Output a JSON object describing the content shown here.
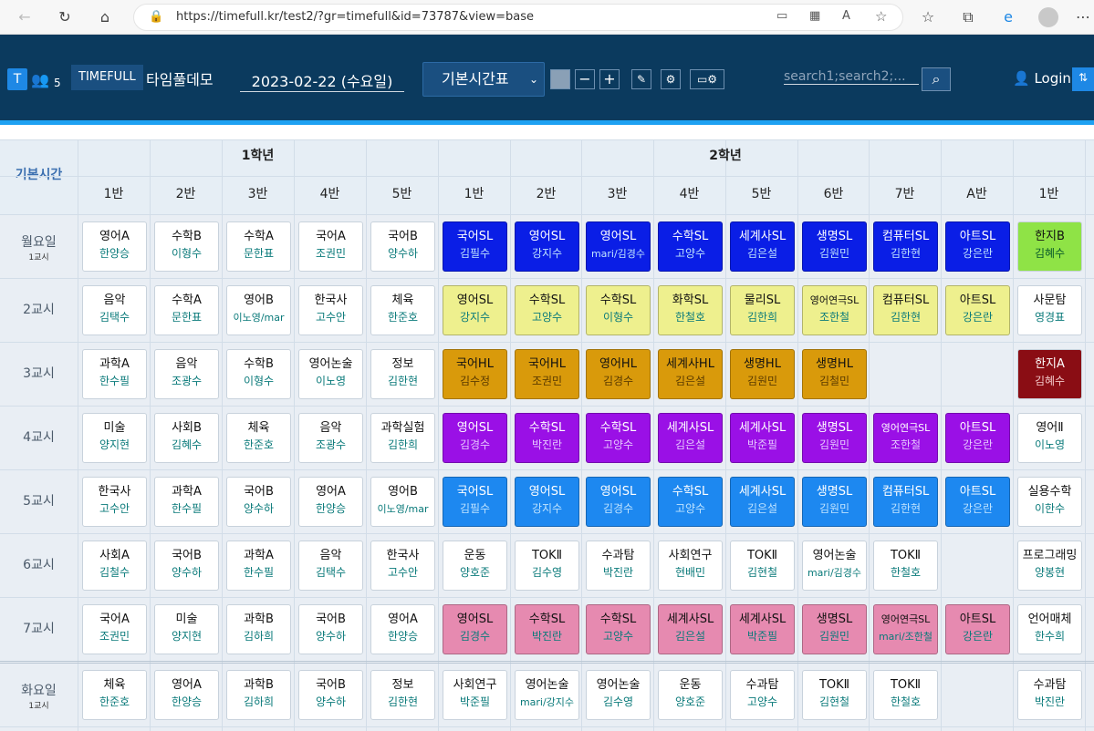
{
  "browser": {
    "url": "https://timefull.kr/test2/?gr=timefull&id=73787&view=base"
  },
  "app": {
    "user_count": "5",
    "brand": "TIMEFULL",
    "name": "타임풀데모",
    "date": "2023-02-22 (수요일)",
    "view_select": "기본시간표",
    "search_placeholder": "search1;search2;...",
    "login": "Login"
  },
  "table": {
    "corner": "기본시간",
    "grades": [
      {
        "label": "1학년"
      },
      {
        "label": "2학년"
      }
    ],
    "columns": [
      "1반",
      "2반",
      "3반",
      "4반",
      "5반",
      "1반",
      "2반",
      "3반",
      "4반",
      "5반",
      "6반",
      "7반",
      "A반",
      "1반"
    ],
    "rows": [
      {
        "day": "월요일",
        "period": "1교시",
        "cells": [
          [
            "영어A",
            "한양승"
          ],
          [
            "수학B",
            "이형수"
          ],
          [
            "수학A",
            "문한표"
          ],
          [
            "국어A",
            "조권민"
          ],
          [
            "국어B",
            "양수하"
          ],
          [
            "국어SL",
            "김필수"
          ],
          [
            "영어SL",
            "강지수"
          ],
          [
            "영어SL",
            "mari/김경수"
          ],
          [
            "수학SL",
            "고양수"
          ],
          [
            "세계사SL",
            "김은설"
          ],
          [
            "생명SL",
            "김원민"
          ],
          [
            "컴퓨터SL",
            "김한현"
          ],
          [
            "아트SL",
            "강은란"
          ],
          [
            "한지B",
            "김혜수"
          ]
        ]
      },
      {
        "day": "",
        "period": "2교시",
        "cells": [
          [
            "음악",
            "김택수"
          ],
          [
            "수학A",
            "문한표"
          ],
          [
            "영어B",
            "이노영/mar"
          ],
          [
            "한국사",
            "고수안"
          ],
          [
            "체육",
            "한준호"
          ],
          [
            "영어SL",
            "강지수"
          ],
          [
            "수학SL",
            "고양수"
          ],
          [
            "수학SL",
            "이형수"
          ],
          [
            "화학SL",
            "한철호"
          ],
          [
            "물리SL",
            "김한희"
          ],
          [
            "영어연극SL",
            "조한철"
          ],
          [
            "컴퓨터SL",
            "김한현"
          ],
          [
            "아트SL",
            "강은란"
          ],
          [
            "사문탐",
            "영경표"
          ]
        ]
      },
      {
        "day": "",
        "period": "3교시",
        "cells": [
          [
            "과학A",
            "한수필"
          ],
          [
            "음악",
            "조광수"
          ],
          [
            "수학B",
            "이형수"
          ],
          [
            "영어논술",
            "이노영"
          ],
          [
            "정보",
            "김한현"
          ],
          [
            "국어HL",
            "김수정"
          ],
          [
            "국어HL",
            "조권민"
          ],
          [
            "영어HL",
            "김경수"
          ],
          [
            "세계사HL",
            "김은설"
          ],
          [
            "생명HL",
            "김원민"
          ],
          [
            "생명HL",
            "김철민"
          ],
          null,
          null,
          [
            "한지A",
            "김혜수"
          ]
        ]
      },
      {
        "day": "",
        "period": "4교시",
        "cells": [
          [
            "미술",
            "양지현"
          ],
          [
            "사회B",
            "김혜수"
          ],
          [
            "체육",
            "한준호"
          ],
          [
            "음악",
            "조광수"
          ],
          [
            "과학실험",
            "김한희"
          ],
          [
            "영어SL",
            "김경수"
          ],
          [
            "수학SL",
            "박진란"
          ],
          [
            "수학SL",
            "고양수"
          ],
          [
            "세계사SL",
            "김은설"
          ],
          [
            "세계사SL",
            "박준필"
          ],
          [
            "생명SL",
            "김원민"
          ],
          [
            "영어연극SL",
            "조한철"
          ],
          [
            "아트SL",
            "강은란"
          ],
          [
            "영어Ⅱ",
            "이노영"
          ]
        ]
      },
      {
        "day": "",
        "period": "5교시",
        "cells": [
          [
            "한국사",
            "고수안"
          ],
          [
            "과학A",
            "한수필"
          ],
          [
            "국어B",
            "양수하"
          ],
          [
            "영어A",
            "한양승"
          ],
          [
            "영어B",
            "이노영/mar"
          ],
          [
            "국어SL",
            "김필수"
          ],
          [
            "영어SL",
            "강지수"
          ],
          [
            "영어SL",
            "김경수"
          ],
          [
            "수학SL",
            "고양수"
          ],
          [
            "세계사SL",
            "김은설"
          ],
          [
            "생명SL",
            "김원민"
          ],
          [
            "컴퓨터SL",
            "김한현"
          ],
          [
            "아트SL",
            "강은란"
          ],
          [
            "실용수학",
            "이한수"
          ]
        ]
      },
      {
        "day": "",
        "period": "6교시",
        "cells": [
          [
            "사회A",
            "김철수"
          ],
          [
            "국어B",
            "양수하"
          ],
          [
            "과학A",
            "한수필"
          ],
          [
            "음악",
            "김택수"
          ],
          [
            "한국사",
            "고수안"
          ],
          [
            "운동",
            "양호준"
          ],
          [
            "TOKⅡ",
            "김수영"
          ],
          [
            "수과탐",
            "박진란"
          ],
          [
            "사회연구",
            "현배민"
          ],
          [
            "TOKⅡ",
            "김현철"
          ],
          [
            "영어논술",
            "mari/김경수"
          ],
          [
            "TOKⅡ",
            "한철호"
          ],
          null,
          [
            "프로그래밍",
            "양봉현"
          ]
        ]
      },
      {
        "day": "",
        "period": "7교시",
        "cells": [
          [
            "국어A",
            "조권민"
          ],
          [
            "미술",
            "양지현"
          ],
          [
            "과학B",
            "김하희"
          ],
          [
            "국어B",
            "양수하"
          ],
          [
            "영어A",
            "한양승"
          ],
          [
            "영어SL",
            "김경수"
          ],
          [
            "수학SL",
            "박진란"
          ],
          [
            "수학SL",
            "고양수"
          ],
          [
            "세계사SL",
            "김은설"
          ],
          [
            "세계사SL",
            "박준필"
          ],
          [
            "생명SL",
            "김원민"
          ],
          [
            "영어연극SL",
            "mari/조한철"
          ],
          [
            "아트SL",
            "강은란"
          ],
          [
            "언어매체",
            "한수희"
          ]
        ]
      },
      {
        "day": "화요일",
        "period": "1교시",
        "cells": [
          [
            "체육",
            "한준호"
          ],
          [
            "영어A",
            "한양승"
          ],
          [
            "과학B",
            "김하희"
          ],
          [
            "국어B",
            "양수하"
          ],
          [
            "정보",
            "김한현"
          ],
          [
            "사회연구",
            "박준필"
          ],
          [
            "영어논술",
            "mari/강지수"
          ],
          [
            "영어논술",
            "김수영"
          ],
          [
            "운동",
            "양호준"
          ],
          [
            "수과탐",
            "고양수"
          ],
          [
            "TOKⅡ",
            "김현철"
          ],
          [
            "TOKⅡ",
            "한철호"
          ],
          null,
          [
            "수과탐",
            "박진란"
          ]
        ]
      }
    ],
    "row_colors": [
      "#0a1ee6",
      "#eef08e",
      "#d99a0b",
      "#9a10e6",
      "#1d88f0",
      "#ffffff",
      "#e68ab0",
      "#ffffff"
    ],
    "row_text_colors": [
      [
        "#ffffff",
        "#bfe3ff"
      ],
      [
        "#111111",
        "#0a7a7a"
      ],
      [
        "#111111",
        "#5a3a00"
      ],
      [
        "#ffffff",
        "#e6c8ff"
      ],
      [
        "#ffffff",
        "#bfe3ff"
      ],
      [
        "#111111",
        "#0a7a7a"
      ],
      [
        "#111111",
        "#0a7a7a"
      ],
      [
        "#111111",
        "#0a7a7a"
      ]
    ],
    "special_cells": {
      "r0c13": "#8fe346",
      "r2c13": "#8a0d14"
    }
  }
}
